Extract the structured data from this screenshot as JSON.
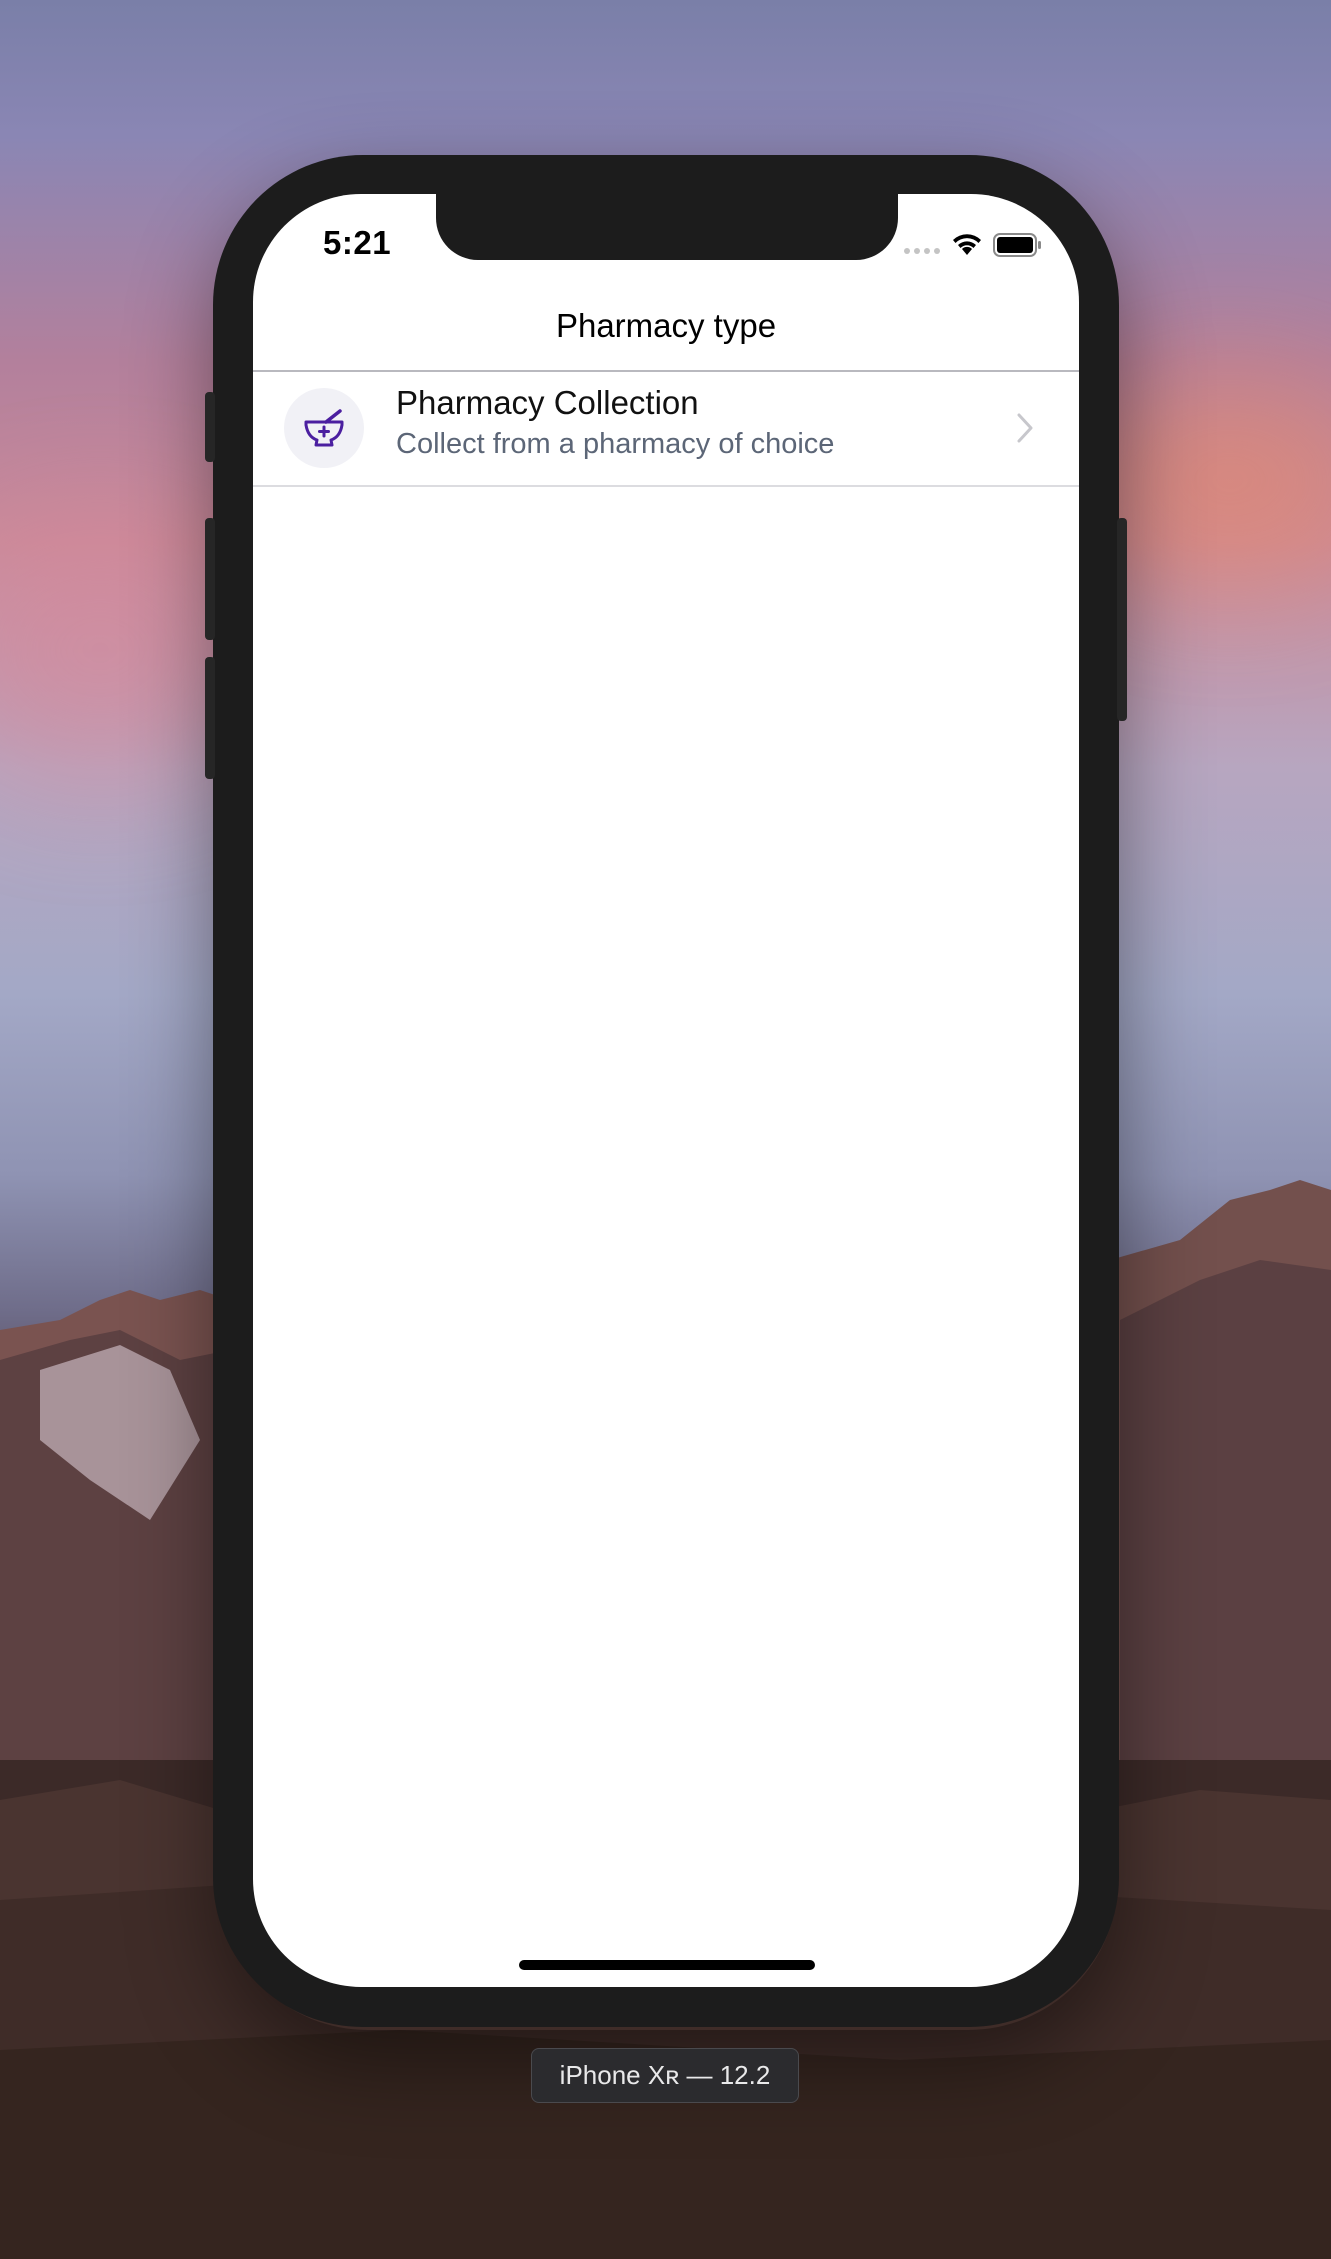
{
  "simulator": {
    "device_label": "iPhone Xʀ — 12.2"
  },
  "status_bar": {
    "time": "5:21",
    "signal_icon": "cellular-signal-icon",
    "wifi_icon": "wifi-icon",
    "battery_icon": "battery-icon"
  },
  "nav": {
    "title": "Pharmacy type"
  },
  "list": {
    "items": [
      {
        "title": "Pharmacy Collection",
        "subtitle": "Collect from a pharmacy of choice",
        "icon": "mortar-pestle-icon",
        "accessory": "chevron-right-icon"
      }
    ]
  },
  "colors": {
    "icon_accent": "#4b1fa0",
    "icon_background": "#f1f1f6",
    "subtitle_text": "#5c6677"
  }
}
